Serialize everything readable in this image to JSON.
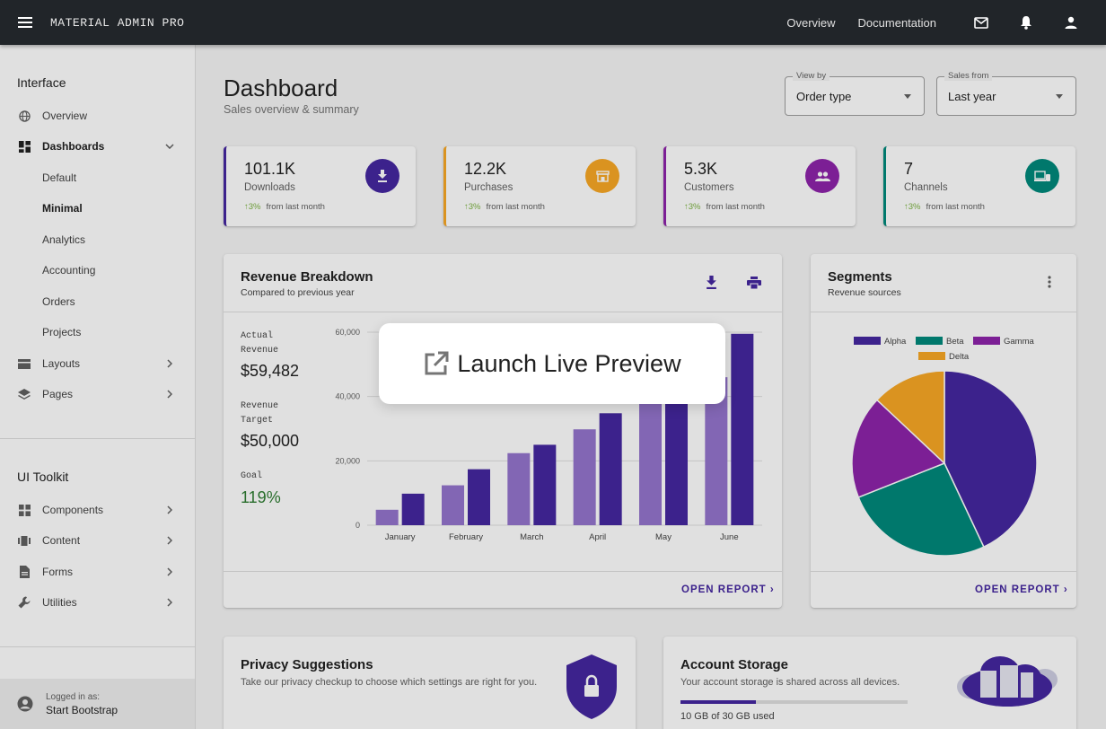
{
  "topbar": {
    "brand": "MATERIAL ADMIN PRO",
    "links": [
      "Overview",
      "Documentation"
    ]
  },
  "sidebar": {
    "interface_heading": "Interface",
    "items": [
      {
        "label": "Overview",
        "icon": "globe-icon"
      },
      {
        "label": "Dashboards",
        "icon": "dashboard-icon"
      },
      {
        "label": "Default"
      },
      {
        "label": "Minimal"
      },
      {
        "label": "Analytics"
      },
      {
        "label": "Accounting"
      },
      {
        "label": "Orders"
      },
      {
        "label": "Projects"
      },
      {
        "label": "Layouts",
        "icon": "layouts-icon"
      },
      {
        "label": "Pages",
        "icon": "layers-icon"
      }
    ],
    "toolkit_heading": "UI Toolkit",
    "toolkit_items": [
      {
        "label": "Components",
        "icon": "components-icon"
      },
      {
        "label": "Content",
        "icon": "content-icon"
      },
      {
        "label": "Forms",
        "icon": "forms-icon"
      },
      {
        "label": "Utilities",
        "icon": "wrench-icon"
      }
    ],
    "footer": {
      "logged_in_as": "Logged in as:",
      "user": "Start Bootstrap"
    }
  },
  "page": {
    "title": "Dashboard",
    "subtitle": "Sales overview & summary",
    "view_by": {
      "legend": "View by",
      "value": "Order type"
    },
    "sales_from": {
      "legend": "Sales from",
      "value": "Last year"
    }
  },
  "stats": [
    {
      "value": "101.1K",
      "label": "Downloads",
      "trend": "3%",
      "trend_text": "from last month",
      "color": "#4527a0",
      "icon": "download-icon"
    },
    {
      "value": "12.2K",
      "label": "Purchases",
      "trend": "3%",
      "trend_text": "from last month",
      "color": "#f9a825",
      "icon": "store-icon"
    },
    {
      "value": "5.3K",
      "label": "Customers",
      "trend": "3%",
      "trend_text": "from last month",
      "color": "#8e24aa",
      "icon": "people-icon"
    },
    {
      "value": "7",
      "label": "Channels",
      "trend": "3%",
      "trend_text": "from last month",
      "color": "#00897b",
      "icon": "devices-icon"
    }
  ],
  "revenue": {
    "title": "Revenue Breakdown",
    "subtitle": "Compared to previous year",
    "actual_label": "Actual Revenue",
    "actual_value": "$59,482",
    "target_label": "Revenue Target",
    "target_value": "$50,000",
    "goal_label": "Goal",
    "goal_value": "119%",
    "open_report": "OPEN REPORT"
  },
  "segments": {
    "title": "Segments",
    "subtitle": "Revenue sources",
    "open_report": "OPEN REPORT"
  },
  "privacy": {
    "title": "Privacy Suggestions",
    "text": "Take our privacy checkup to choose which settings are right for you."
  },
  "storage": {
    "title": "Account Storage",
    "text": "Your account storage is shared across all devices.",
    "used_text": "10 GB of 30 GB used",
    "used_fraction": 0.333
  },
  "preview_button": "Launch Live Preview",
  "chart_data": [
    {
      "type": "bar",
      "categories": [
        "January",
        "February",
        "March",
        "April",
        "May",
        "June"
      ],
      "series": [
        {
          "values": [
            4800,
            12400,
            22400,
            29800,
            38000,
            46000
          ],
          "color": "#9575cd"
        },
        {
          "values": [
            9800,
            17400,
            25000,
            34800,
            44000,
            59500
          ],
          "color": "#4527a0"
        }
      ],
      "ylim": [
        0,
        60000
      ],
      "yticks": [
        "0",
        "20,000",
        "40,000",
        "60,000"
      ],
      "ytick_values": [
        0,
        20000,
        40000,
        60000
      ],
      "grid": true
    },
    {
      "type": "pie",
      "labels": [
        "Alpha",
        "Beta",
        "Gamma",
        "Delta"
      ],
      "values": [
        43,
        26,
        18,
        13
      ],
      "colors": [
        "#4527a0",
        "#00897b",
        "#8e24aa",
        "#f9a825"
      ],
      "legend": "top"
    }
  ]
}
